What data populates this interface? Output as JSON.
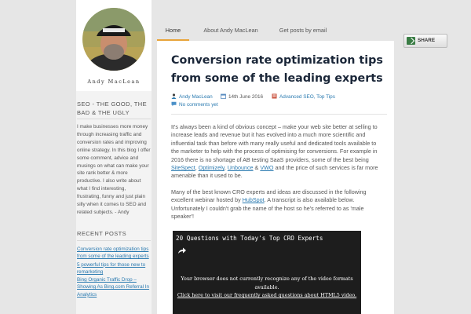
{
  "sidebar": {
    "signature": "Andy MacLean",
    "site_title": "SEO - THE GOOD, THE BAD & THE UGLY",
    "about": "I make businesses more money through increasing traffic and conversion rates and improving online strategy. In this blog I offer some comment, advice and musings on what can make your site rank better & more productive. I also write about what I find interesting, frustrating, funny and just plain silly when it comes to SEO and related subjects. - Andy",
    "recent_title": "RECENT POSTS",
    "recent_posts": [
      "Conversion rate optimization tips from some of the leading experts",
      "5 powerful tips for those new to remarketing",
      "Bing Organic Traffic Drop – Showing As Bing.com Referral In Analytics"
    ]
  },
  "nav": {
    "home": "Home",
    "about": "About Andy MacLean",
    "posts": "Get posts by email"
  },
  "share": {
    "label": "SHARE"
  },
  "post": {
    "title": "Conversion rate optimization tips from some of the leading experts",
    "author": "Andy MacLean",
    "date": "14th June 2016",
    "categories": "Advanced SEO, Top Tips",
    "comments": "No comments yet",
    "p1_a": "It's always been a kind of obvious concept – make your web site better at selling to increase leads and revenue but it has evolved into a much more scientific and influential task than before with many really useful and dedicated tools available to the marketer to help with the process of optimising for conversions. For example in 2016 there is no shortage of AB testing SaaS providers, some of the best being ",
    "link_sitespect": "SiteSpect",
    "comma1": ", ",
    "link_optimizely": "Optimizely",
    "comma2": ", ",
    "link_unbounce": "Unbounce",
    "amp": " & ",
    "link_vwo": "VWO",
    "p1_b": " and the price of such services is far more amenable than it used to be.",
    "p2_a": "Many of the best known CRO experts and ideas are discussed in the following excellent webinar hosted by ",
    "link_hubspot": "HubSpot",
    "p2_b": ". A transcript is also available below. Unfortunately I couldn't grab the name of the host so he's referred to as 'male speaker'!"
  },
  "video": {
    "title": "20 Questions with Today's Top CRO Experts",
    "msg": "Your browser does not currently recognize any of the video formats available.",
    "link": "Click here to visit our frequently asked questions about HTML5 video."
  },
  "colors": {
    "accent": "#e8a43a",
    "link": "#2a7ab0",
    "title": "#1a2638"
  }
}
